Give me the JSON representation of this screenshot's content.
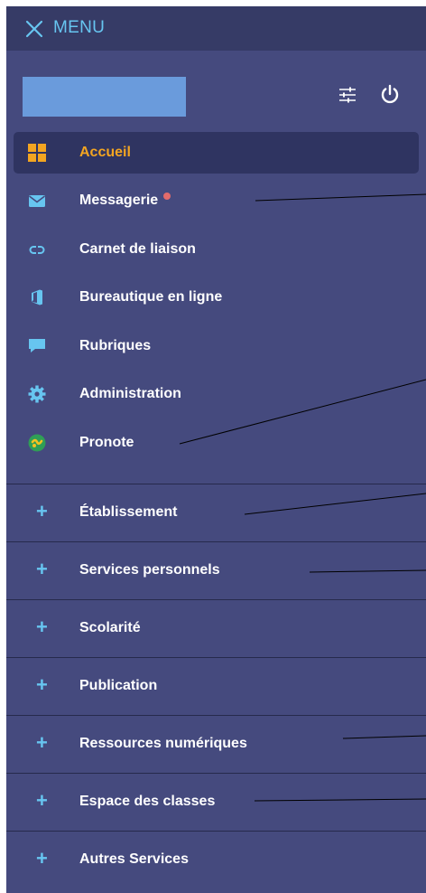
{
  "header": {
    "title": "MENU"
  },
  "nav": {
    "items": [
      {
        "label": "Accueil",
        "icon": "grid-icon"
      },
      {
        "label": "Messagerie",
        "icon": "envelope-icon"
      },
      {
        "label": "Carnet de liaison",
        "icon": "link-icon"
      },
      {
        "label": "Bureautique en ligne",
        "icon": "office-icon"
      },
      {
        "label": "Rubriques",
        "icon": "chat-icon"
      },
      {
        "label": "Administration",
        "icon": "gear-icon"
      },
      {
        "label": "Pronote",
        "icon": "pronote-icon"
      }
    ]
  },
  "sections": [
    "Établissement",
    "Services personnels",
    "Scolarité",
    "Publication",
    "Ressources numériques",
    "Espace des classes",
    "Autres Services"
  ],
  "colors": {
    "panel": "#454a7e",
    "topbar": "#363b66",
    "accent": "#67c5f0",
    "active_label": "#f3a521",
    "notification": "#e36b6b"
  }
}
